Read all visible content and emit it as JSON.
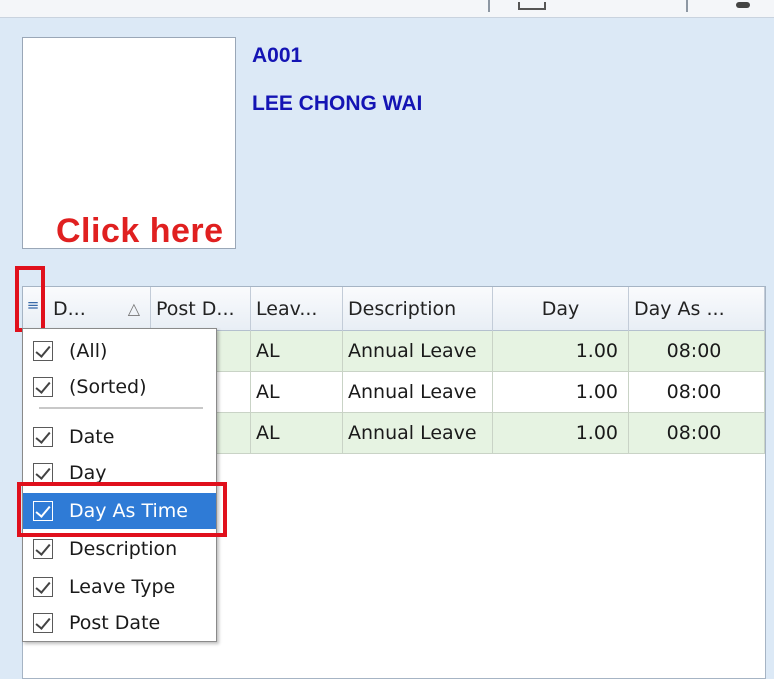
{
  "employee": {
    "code": "A001",
    "name": "LEE CHONG WAI"
  },
  "annotation": {
    "text": "Click here",
    "color": "#e02020"
  },
  "grid": {
    "columns": [
      "D...",
      "Post D...",
      "Leav...",
      "Description",
      "Day",
      "Day As ..."
    ],
    "sort_indicator": "△",
    "rows": [
      {
        "date": "",
        "post_date": "/...",
        "leave": "AL",
        "description": "Annual Leave",
        "day": "1.00",
        "day_as_time": "08:00"
      },
      {
        "date": "",
        "post_date": "/...",
        "leave": "AL",
        "description": "Annual Leave",
        "day": "1.00",
        "day_as_time": "08:00"
      },
      {
        "date": "",
        "post_date": "/...",
        "leave": "AL",
        "description": "Annual Leave",
        "day": "1.00",
        "day_as_time": "08:00"
      }
    ],
    "row_color": "#e6f3e2"
  },
  "column_chooser": {
    "icon": "column-chooser-icon",
    "items": [
      {
        "label": "(All)",
        "checked": true
      },
      {
        "label": "(Sorted)",
        "checked": true
      },
      {
        "label": "Date",
        "checked": true
      },
      {
        "label": "Day",
        "checked": true
      },
      {
        "label": "Day As Time",
        "checked": true,
        "selected": true
      },
      {
        "label": "Description",
        "checked": true
      },
      {
        "label": "Leave Type",
        "checked": true
      },
      {
        "label": "Post Date",
        "checked": true
      }
    ],
    "selected_color": "#2f7bd6"
  }
}
